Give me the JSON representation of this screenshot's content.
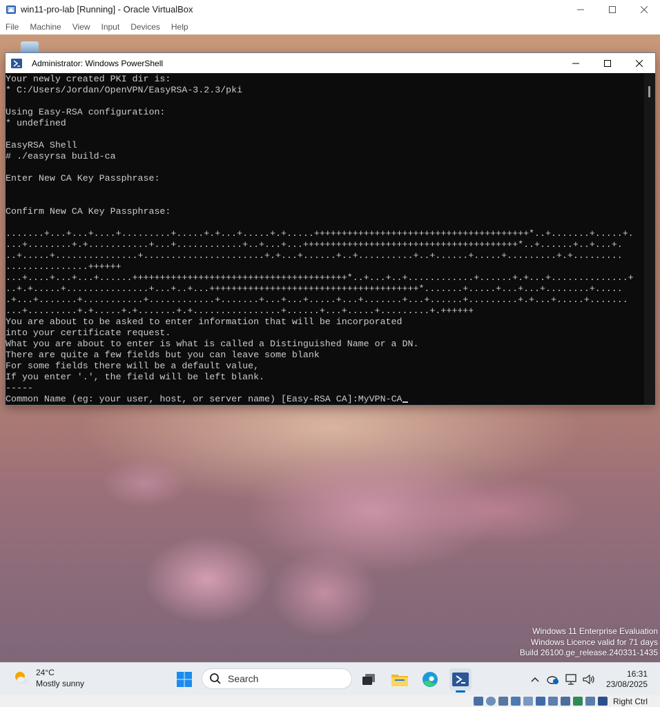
{
  "vbox": {
    "title": "win11-pro-lab [Running] - Oracle VirtualBox",
    "menu": [
      "File",
      "Machine",
      "View",
      "Input",
      "Devices",
      "Help"
    ],
    "host_key": "Right Ctrl"
  },
  "powershell": {
    "title": "Administrator: Windows PowerShell",
    "lines": [
      "Your newly created PKI dir is:",
      "* C:/Users/Jordan/OpenVPN/EasyRSA-3.2.3/pki",
      "",
      "Using Easy-RSA configuration:",
      "* undefined",
      "",
      "EasyRSA Shell",
      "# ./easyrsa build-ca",
      "",
      "Enter New CA Key Passphrase:",
      "",
      "",
      "Confirm New CA Key Passphrase:",
      "",
      ".......+...+...+....+.........+.....+.+...+.....+.+.....+++++++++++++++++++++++++++++++++++++++*..+.......+.....+.",
      "...+........+.+...........+...+............+..+...+...+++++++++++++++++++++++++++++++++++++++*..+......+..+...+.",
      "..+.....+...............+......................+.+...+......+..+..........+..+......+.....+.........+.+.........",
      "...............++++++",
      "...+....+...+...+......+++++++++++++++++++++++++++++++++++++++*..+...+..+............+......+.+...+..............+",
      "..+.+.....+...............+...+..+...++++++++++++++++++++++++++++++++++++++*.......+.....+...+...+........+.....",
      ".+...+.......+...........+............+.......+...+...+.....+...+.......+...+......+.........+.+...+.....+.......",
      "...+.........+.+.....+.+.......+.+................+......+...+.....+.........+.++++++",
      "You are about to be asked to enter information that will be incorporated",
      "into your certificate request.",
      "What you are about to enter is what is called a Distinguished Name or a DN.",
      "There are quite a few fields but you can leave some blank",
      "For some fields there will be a default value,",
      "If you enter '.', the field will be left blank.",
      "-----"
    ],
    "prompt": "Common Name (eg: your user, host, or server name) [Easy-RSA CA]:",
    "input_value": "MyVPN-CA"
  },
  "watermark": {
    "line1": "Windows 11 Enterprise Evaluation",
    "line2": "Windows Licence valid for 71 days",
    "line3": "Build 26100.ge_release.240331-1435"
  },
  "taskbar": {
    "weather_temp": "24°C",
    "weather_condition": "Mostly sunny",
    "search_placeholder": "Search",
    "apps": [
      "file-explorer-icon",
      "edge-icon",
      "task-view-icon",
      "powershell-icon"
    ],
    "time": "16:31",
    "date": "23/08/2025"
  },
  "colors": {
    "console_bg": "#0c0c0c",
    "console_fg": "#cccccc",
    "accent": "#0067c0"
  }
}
